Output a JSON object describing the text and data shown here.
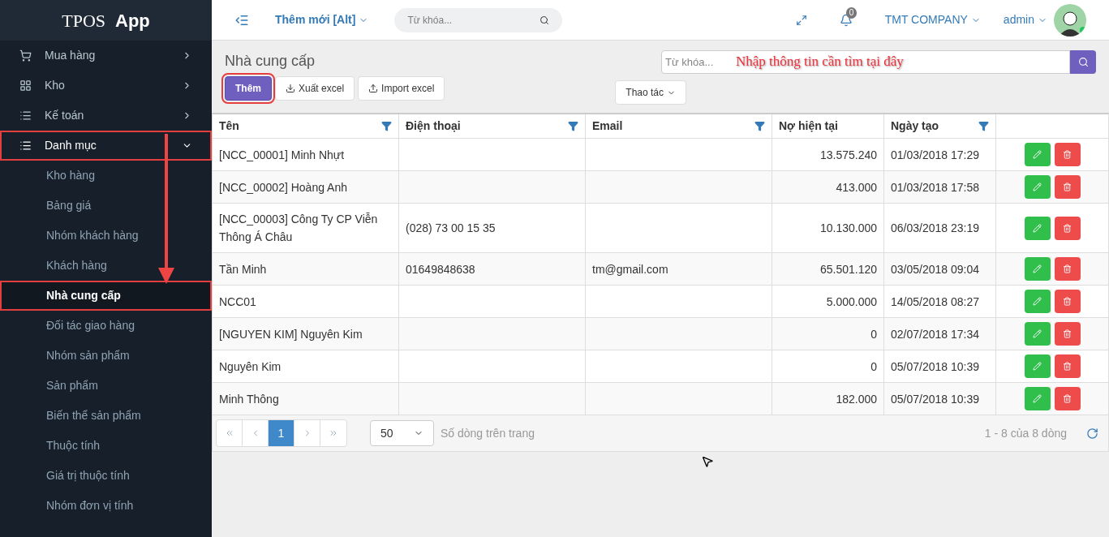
{
  "brand": {
    "name": "TPOS",
    "suffix": "App"
  },
  "topbar": {
    "new_menu": "Thêm mới [Alt]",
    "search_placeholder": "Từ khóa...",
    "notifications": "0",
    "company": "TMT COMPANY",
    "user": "admin"
  },
  "sidebar": {
    "items": [
      {
        "label": "Mua hàng",
        "expanded": false,
        "highlighted": false
      },
      {
        "label": "Kho",
        "expanded": false,
        "highlighted": false
      },
      {
        "label": "Kế toán",
        "expanded": false,
        "highlighted": false
      },
      {
        "label": "Danh mục",
        "expanded": true,
        "highlighted": true,
        "children": [
          {
            "label": "Kho hàng",
            "selected": false,
            "highlighted": false
          },
          {
            "label": "Bảng giá",
            "selected": false,
            "highlighted": false
          },
          {
            "label": "Nhóm khách hàng",
            "selected": false,
            "highlighted": false
          },
          {
            "label": "Khách hàng",
            "selected": false,
            "highlighted": false
          },
          {
            "label": "Nhà cung cấp",
            "selected": true,
            "highlighted": true
          },
          {
            "label": "Đối tác giao hàng",
            "selected": false,
            "highlighted": false
          },
          {
            "label": "Nhóm sản phẩm",
            "selected": false,
            "highlighted": false
          },
          {
            "label": "Sản phẩm",
            "selected": false,
            "highlighted": false
          },
          {
            "label": "Biến thể sản phẩm",
            "selected": false,
            "highlighted": false
          },
          {
            "label": "Thuộc tính",
            "selected": false,
            "highlighted": false
          },
          {
            "label": "Giá trị thuộc tính",
            "selected": false,
            "highlighted": false
          },
          {
            "label": "Nhóm đơn vị tính",
            "selected": false,
            "highlighted": false
          }
        ]
      }
    ]
  },
  "page": {
    "title": "Nhà cung cấp",
    "search_placeholder": "Từ khóa...",
    "annotation": "Nhập thông tin cần tìm tại đây",
    "buttons": [
      {
        "label": "Thêm",
        "kind": "primary",
        "highlighted": true
      },
      {
        "label": "Xuất excel",
        "kind": "download",
        "highlighted": false
      },
      {
        "label": "Import excel",
        "kind": "upload",
        "highlighted": false
      }
    ],
    "actions_menu": "Thao tác"
  },
  "table": {
    "columns": [
      {
        "label": "Tên",
        "filter": true
      },
      {
        "label": "Điện thoại",
        "filter": true
      },
      {
        "label": "Email",
        "filter": true
      },
      {
        "label": "Nợ hiện tại",
        "filter": false
      },
      {
        "label": "Ngày tạo",
        "filter": true
      }
    ],
    "rows": [
      [
        "[NCC_00001] Minh Nhựt",
        "",
        "",
        "13.575.240",
        "01/03/2018 17:29"
      ],
      [
        "[NCC_00002] Hoàng Anh",
        "",
        "",
        "413.000",
        "01/03/2018 17:58"
      ],
      [
        "[NCC_00003] Công Ty CP Viễn Thông Á Châu",
        "(028) 73 00 15 35",
        "",
        "10.130.000",
        "06/03/2018 23:19"
      ],
      [
        "Tần Minh",
        "01649848638",
        "tm@gmail.com",
        "65.501.120",
        "03/05/2018 09:04"
      ],
      [
        "NCC01",
        "",
        "",
        "5.000.000",
        "14/05/2018 08:27"
      ],
      [
        "[NGUYEN KIM] Nguyên Kim",
        "",
        "",
        "0",
        "02/07/2018 17:34"
      ],
      [
        "Nguyên Kim",
        "",
        "",
        "0",
        "05/07/2018 10:39"
      ],
      [
        "Minh Thông",
        "",
        "",
        "182.000",
        "05/07/2018 10:39"
      ]
    ]
  },
  "pager": {
    "pages": [
      {
        "label": "1",
        "selected": true
      }
    ],
    "page_size": "50",
    "page_size_label": "Số dòng trên trang",
    "summary": "1 - 8 của 8 dòng"
  }
}
